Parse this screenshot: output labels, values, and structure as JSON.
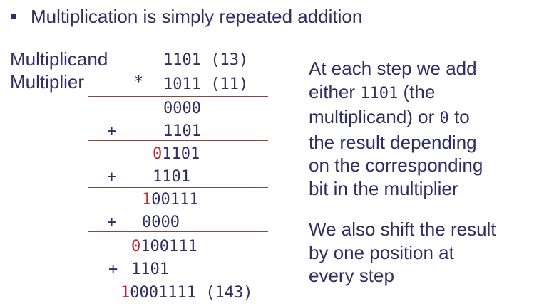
{
  "bullet": "Multiplication is simply repeated addition",
  "labels": {
    "multiplicand": "Multiplicand",
    "multiplier": "Multiplier"
  },
  "calc": {
    "multiplicand_value": "1101 (13)",
    "multiplier_op": "*",
    "multiplier_value": "1011 (11)",
    "row1": "0000",
    "plus": "+",
    "row2": "1101",
    "row3_red": "0",
    "row3_rest": "1101",
    "row4": "1101",
    "row5_red": "1",
    "row5_rest": "00111",
    "row6": "0000",
    "row7_red": "0",
    "row7_rest": "100111",
    "row8": "1101",
    "result_red": "1",
    "result_rest": "0001111 (143)"
  },
  "explanation": {
    "p1_line1": "At each step we add",
    "p1_line2_a": "either ",
    "p1_line2_code": "1101",
    "p1_line2_b": " (the",
    "p1_line3_a": "multiplicand) or ",
    "p1_line3_code": "0",
    "p1_line3_b": " to",
    "p1_line4": "the result depending",
    "p1_line5": "on the corresponding",
    "p1_line6": "bit in the multiplier",
    "p2_line1": "We also shift the result",
    "p2_line2": "by one position at",
    "p2_line3": "every step"
  },
  "colors": {
    "text": "#2f2f63",
    "highlight": "#c2262e",
    "rule": "#8d4444"
  }
}
